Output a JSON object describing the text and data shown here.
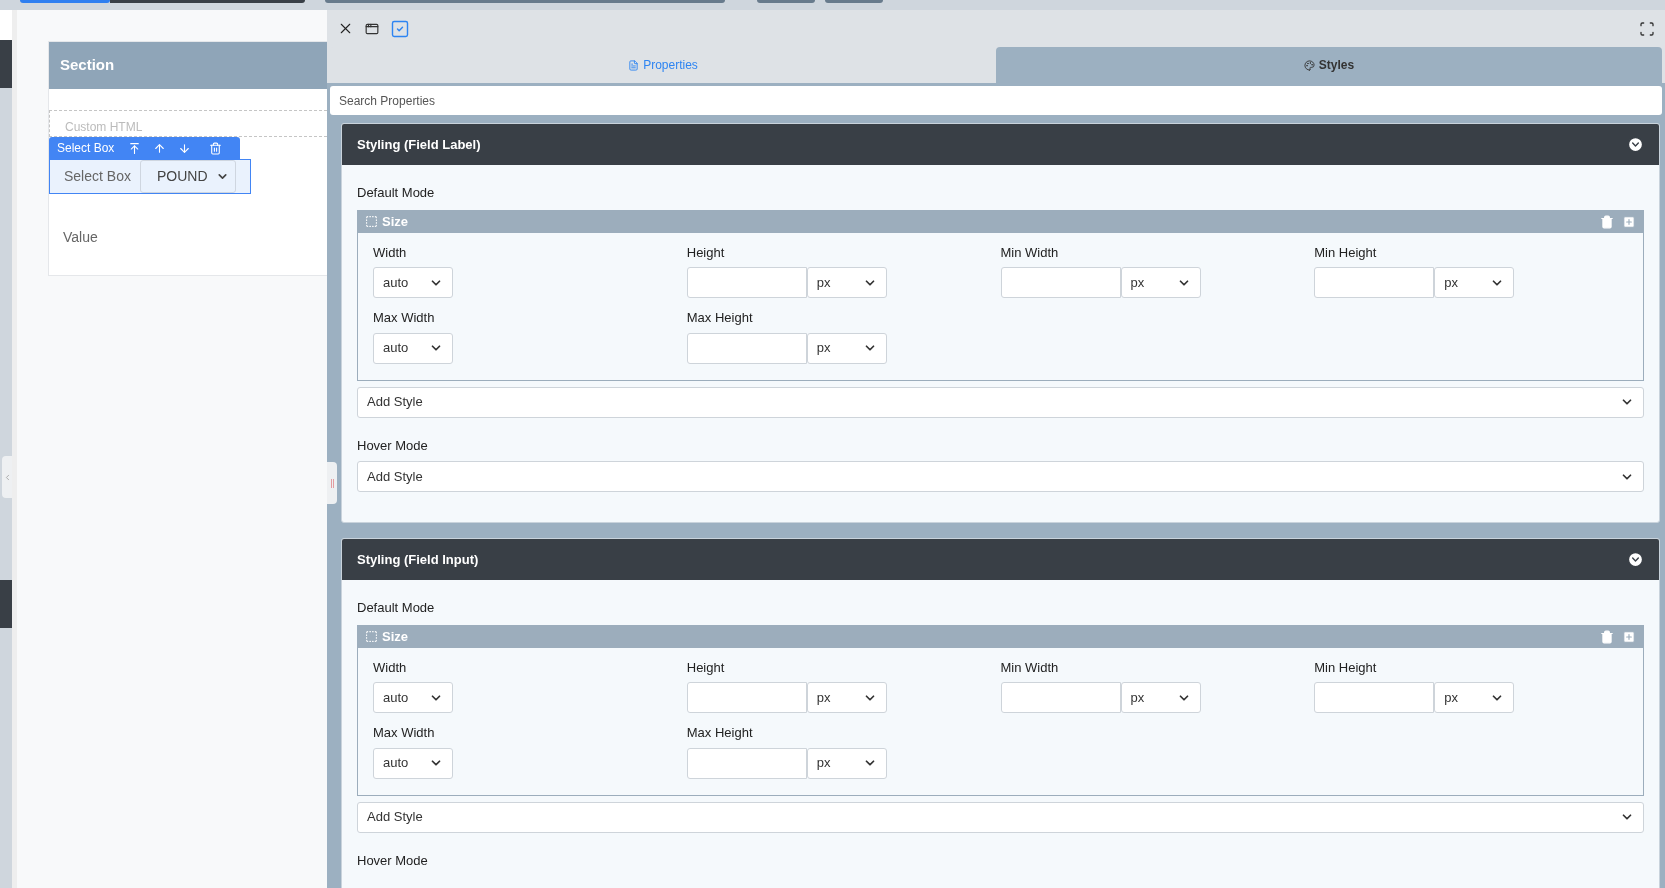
{
  "canvas": {
    "section": {
      "title": "Section",
      "custom_html": "Custom HTML",
      "component": {
        "toolbar_label": "Select Box",
        "label": "Select Box",
        "value": "POUND"
      },
      "value_label": "Value"
    }
  },
  "panel": {
    "tabs": [
      {
        "label": "Properties",
        "selected": false
      },
      {
        "label": "Styles",
        "selected": true
      }
    ],
    "search": {
      "placeholder": "Search Properties"
    },
    "cards": [
      {
        "title": "Styling (Field Label)",
        "default_mode": "Default Mode",
        "group": {
          "title": "Size",
          "fields": [
            {
              "label": "Width",
              "kind": "select",
              "value": "auto"
            },
            {
              "label": "Height",
              "kind": "length",
              "unit": "px"
            },
            {
              "label": "Min Width",
              "kind": "length",
              "unit": "px"
            },
            {
              "label": "Min Height",
              "kind": "length",
              "unit": "px"
            },
            {
              "label": "Max Width",
              "kind": "select",
              "value": "auto"
            },
            {
              "label": "Max Height",
              "kind": "length",
              "unit": "px"
            }
          ]
        },
        "add_style": "Add Style",
        "hover_mode": "Hover Mode",
        "hover_add_style": "Add Style"
      },
      {
        "title": "Styling (Field Input)",
        "default_mode": "Default Mode",
        "group": {
          "title": "Size",
          "fields": [
            {
              "label": "Width",
              "kind": "select",
              "value": "auto"
            },
            {
              "label": "Height",
              "kind": "length",
              "unit": "px"
            },
            {
              "label": "Min Width",
              "kind": "length",
              "unit": "px"
            },
            {
              "label": "Min Height",
              "kind": "length",
              "unit": "px"
            },
            {
              "label": "Max Width",
              "kind": "select",
              "value": "auto"
            },
            {
              "label": "Max Height",
              "kind": "length",
              "unit": "px"
            }
          ]
        },
        "add_style": "Add Style",
        "hover_mode": "Hover Mode"
      }
    ]
  }
}
